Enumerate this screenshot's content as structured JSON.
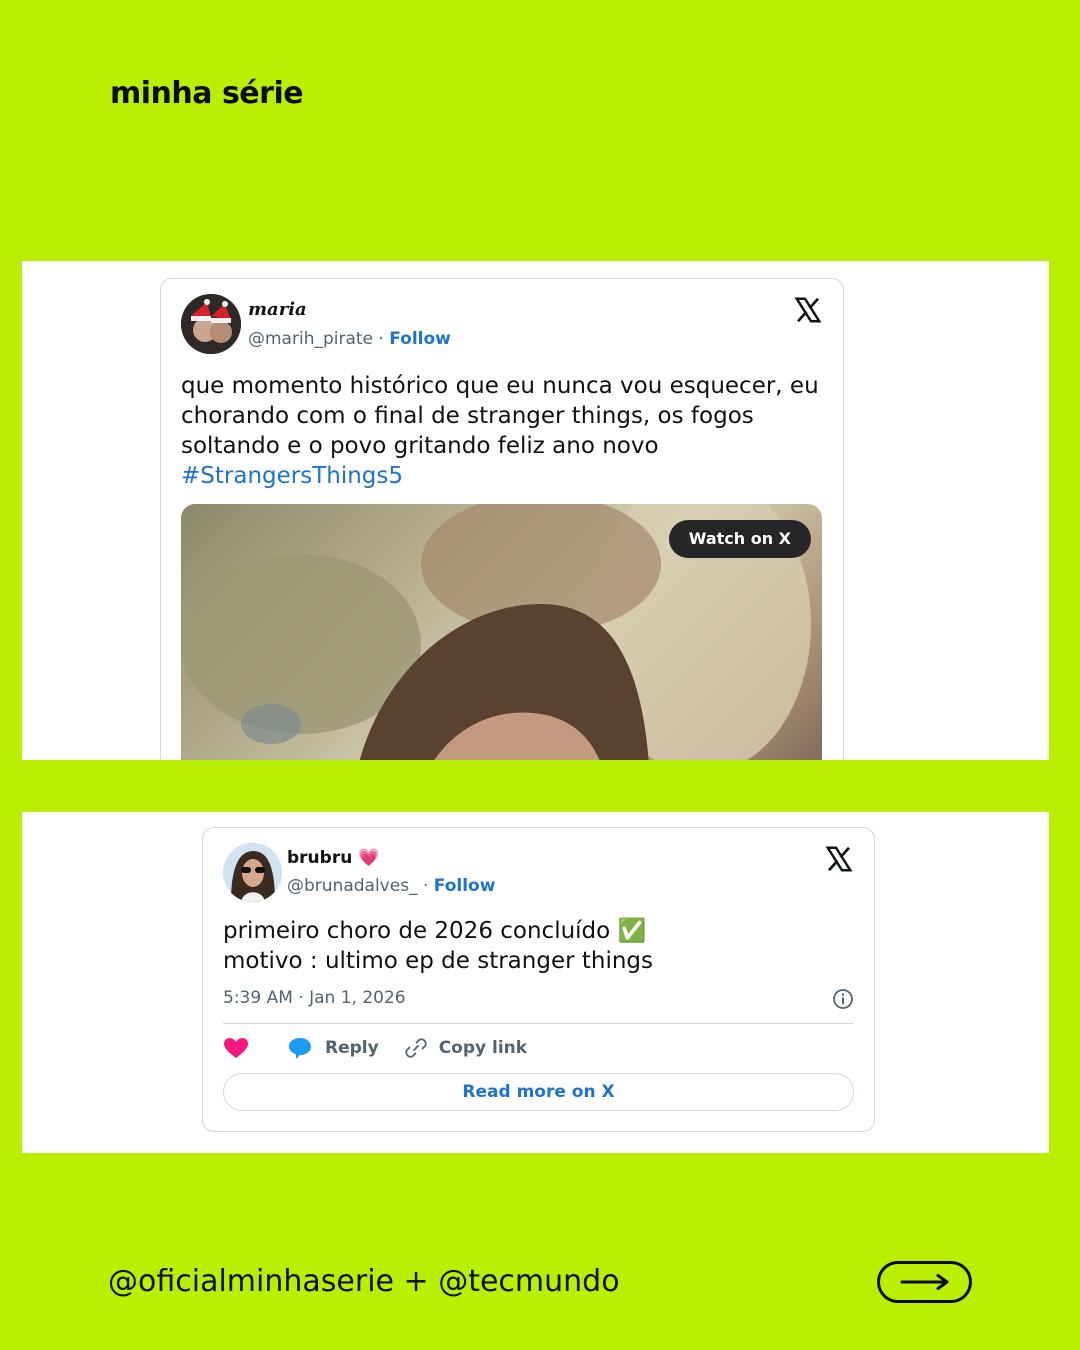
{
  "brand": {
    "logo_text": "minha série"
  },
  "tweet1": {
    "display_name": "maria",
    "handle": "@marih_pirate",
    "separator": " · ",
    "follow_label": "Follow",
    "text": "que momento histórico que eu nunca vou esquecer, eu chorando com o final de stranger things, os fogos soltando e o povo gritando feliz ano novo ",
    "hashtag": "#StrangersThings5",
    "media_button": "Watch on X"
  },
  "tweet2": {
    "display_name": "brubru",
    "name_emoji": "💗",
    "handle": "@brunadalves_",
    "separator": " · ",
    "follow_label": "Follow",
    "line1": "primeiro choro de 2026 concluído ✅",
    "line2": "motivo : ultimo ep de stranger things",
    "timestamp": "5:39 AM · Jan 1, 2026",
    "reply_label": "Reply",
    "copy_label": "Copy link",
    "read_more": "Read more on X"
  },
  "footer": {
    "credit": "@oficialminhaserie + @tecmundo",
    "next_icon": "arrow-right-icon"
  },
  "colors": {
    "background": "#b9ef00",
    "link": "#1d73d1",
    "heart": "#f91880",
    "reply": "#1d9bf0"
  }
}
